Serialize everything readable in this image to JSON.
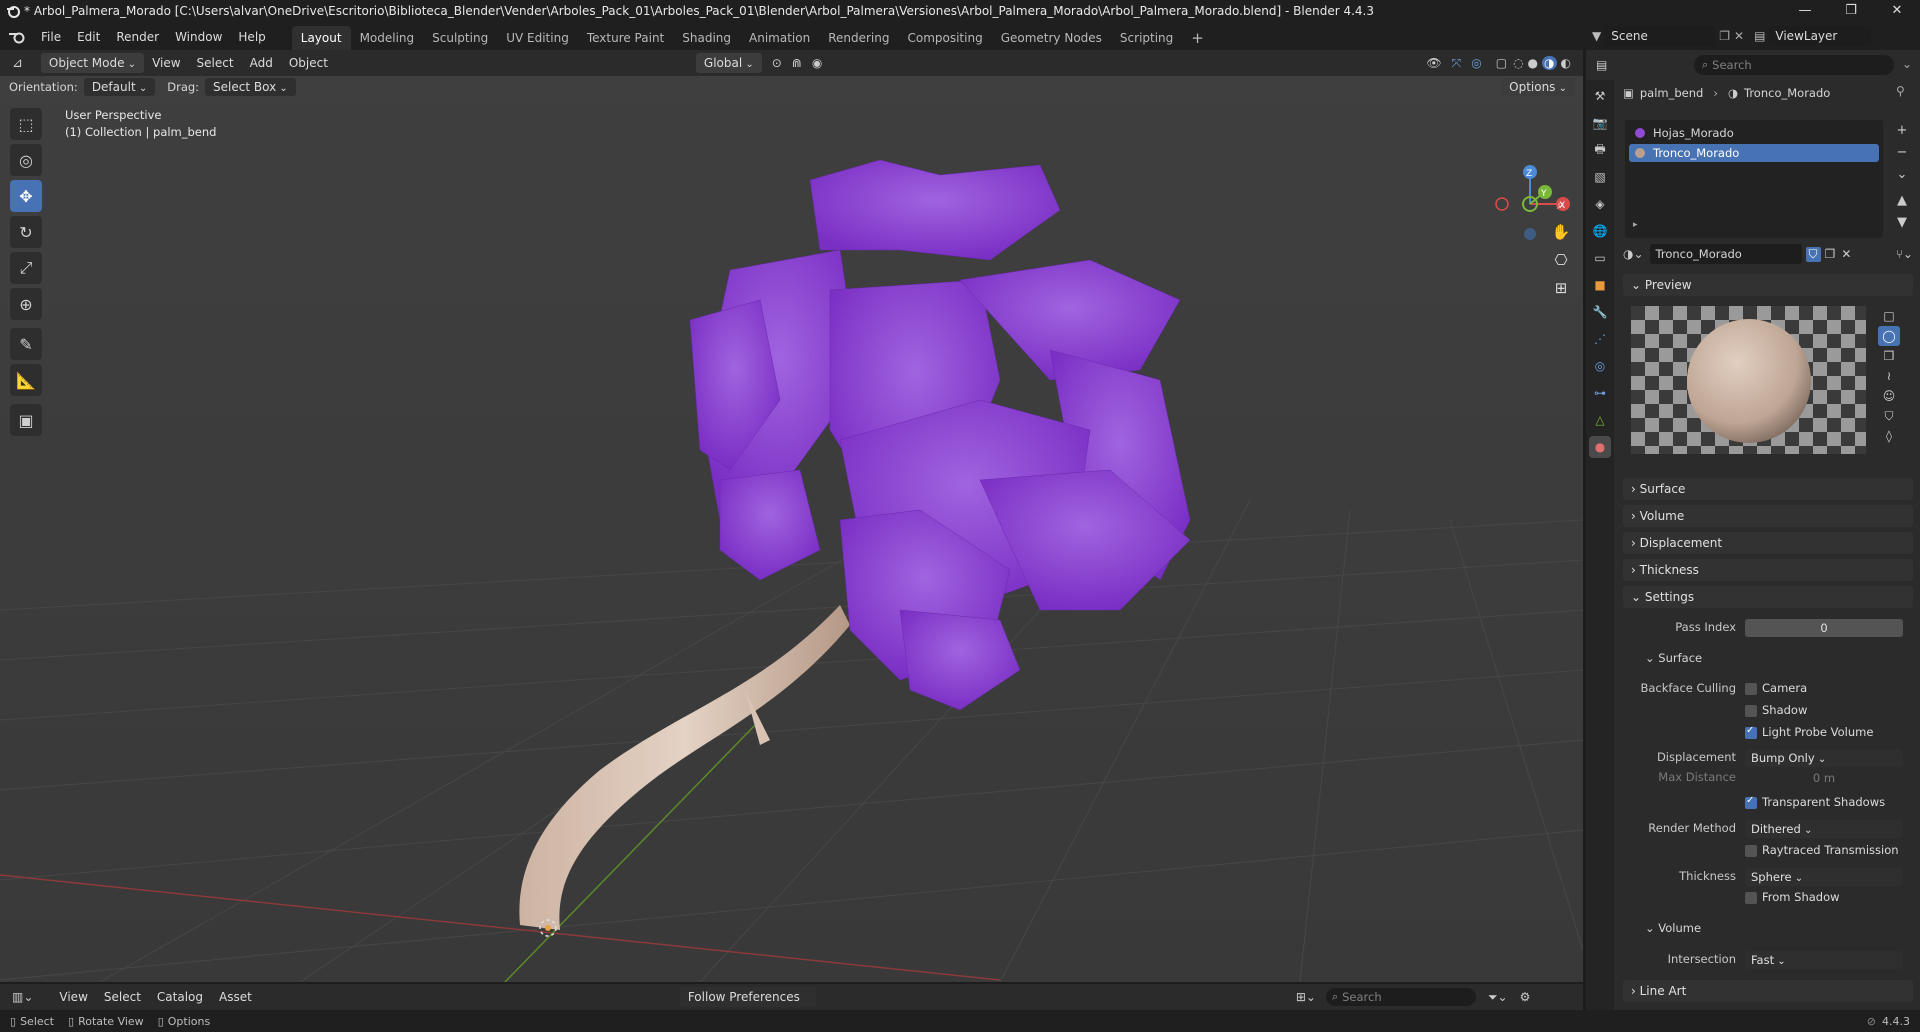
{
  "window": {
    "title": "* Arbol_Palmera_Morado [C:\\Users\\alvar\\OneDrive\\Escritorio\\Biblioteca_Blender\\Vender\\Arboles_Pack_01\\Arboles_Pack_01\\Blender\\Arbol_Palmera\\Versiones\\Arbol_Palmera_Morado\\Arbol_Palmera_Morado.blend] - Blender 4.4.3",
    "minimize": "—",
    "maximize": "❐",
    "close": "✕"
  },
  "menu": [
    "File",
    "Edit",
    "Render",
    "Window",
    "Help"
  ],
  "workspaces": [
    "Layout",
    "Modeling",
    "Sculpting",
    "UV Editing",
    "Texture Paint",
    "Shading",
    "Animation",
    "Rendering",
    "Compositing",
    "Geometry Nodes",
    "Scripting"
  ],
  "active_workspace": "Layout",
  "scene": {
    "label": "Scene",
    "viewlayer": "ViewLayer"
  },
  "viewport_header": {
    "mode": "Object Mode",
    "menus": [
      "View",
      "Select",
      "Add",
      "Object"
    ],
    "transform_orientation": "Global"
  },
  "tool_options": {
    "orientation_label": "Orientation:",
    "orientation_value": "Default",
    "drag_label": "Drag:",
    "drag_value": "Select Box",
    "options_label": "Options"
  },
  "viewport": {
    "perspective": "User Perspective",
    "collection": "(1) Collection | palm_bend",
    "gizmo": {
      "z": "Z",
      "y": "Y",
      "x": "X"
    }
  },
  "properties": {
    "search_placeholder": "Search",
    "breadcrumb_object": "palm_bend",
    "breadcrumb_material": "Tronco_Morado",
    "slots": [
      {
        "name": "Hojas_Morado",
        "color": "#8e4ad0",
        "selected": false
      },
      {
        "name": "Tronco_Morado",
        "color": "#b9a08e",
        "selected": true
      }
    ],
    "material_name": "Tronco_Morado",
    "sections": {
      "preview": "Preview",
      "surface": "Surface",
      "volume": "Volume",
      "displacement": "Displacement",
      "thickness": "Thickness",
      "settings": "Settings",
      "line_art": "Line Art"
    },
    "settings": {
      "pass_index_label": "Pass Index",
      "pass_index_value": "0",
      "surface_sub": "Surface",
      "backface_label": "Backface Culling",
      "camera": "Camera",
      "shadow": "Shadow",
      "light_probe": "Light Probe Volume",
      "displacement_label": "Displacement",
      "displacement_value": "Bump Only",
      "max_distance_label": "Max Distance",
      "max_distance_value": "0 m",
      "transparent_shadows": "Transparent Shadows",
      "render_method_label": "Render Method",
      "render_method_value": "Dithered",
      "raytraced": "Raytraced Transmission",
      "thickness_label": "Thickness",
      "thickness_value": "Sphere",
      "from_shadow": "From Shadow",
      "volume_sub": "Volume",
      "intersection_label": "Intersection",
      "intersection_value": "Fast"
    }
  },
  "timeline": {
    "menus": [
      "View",
      "Select",
      "Catalog",
      "Asset"
    ],
    "follow": "Follow Preferences",
    "search_placeholder": "Search"
  },
  "status": {
    "select": "Select",
    "rotate": "Rotate View",
    "options": "Options",
    "version": "4.4.3"
  }
}
